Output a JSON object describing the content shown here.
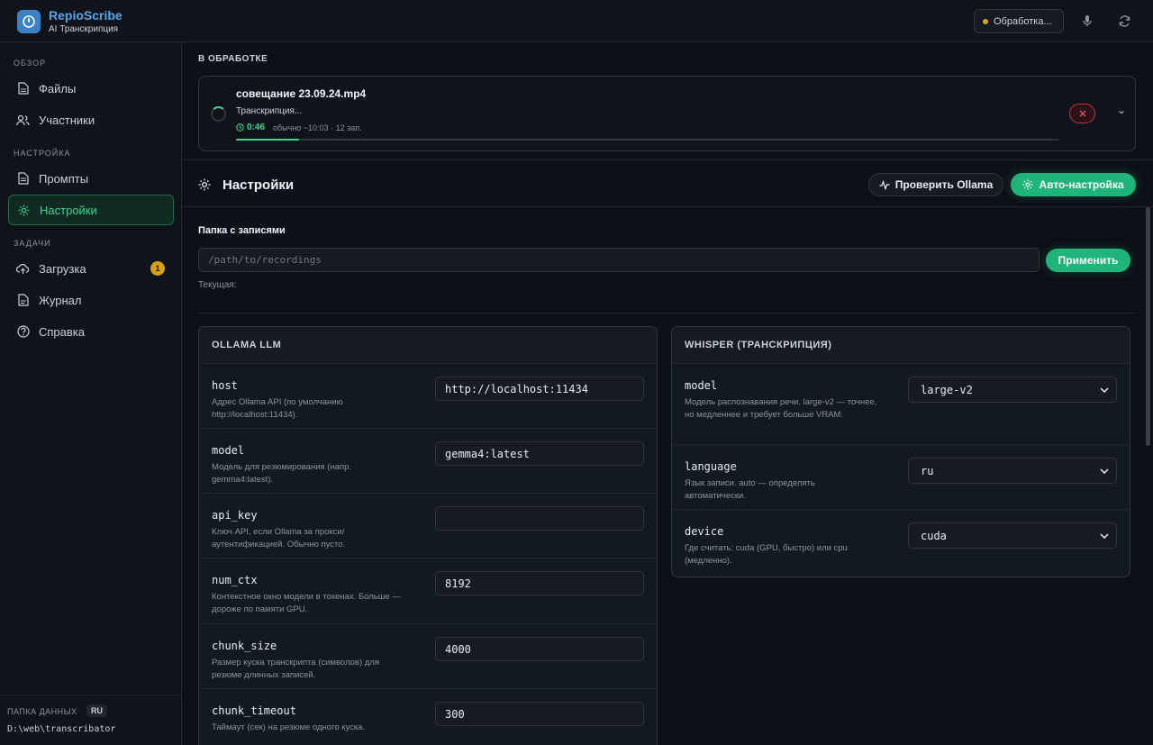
{
  "app": {
    "title": "RepioScribe",
    "subtitle": "AI Транскрипция",
    "status": "Обработка..."
  },
  "sidebar": {
    "sections": {
      "overview": "ОБЗОР",
      "settings": "НАСТРОЙКА",
      "tasks": "ЗАДАЧИ"
    },
    "items": {
      "files": "Файлы",
      "participants": "Участники",
      "prompts": "Промпты",
      "settings": "Настройки",
      "upload": "Загрузка",
      "upload_badge": "1",
      "journal": "Журнал",
      "help": "Справка"
    },
    "footer": {
      "label": "ПАПКА ДАННЫХ",
      "lang": "RU",
      "path": "D:\\web\\transcribator"
    }
  },
  "processing": {
    "label": "В ОБРАБОТКЕ",
    "file_name": "совещание 23.09.24.mp4",
    "status": "Транскрипция...",
    "timer": "0:46",
    "note": "обычно ~10:03 · 12 зап.",
    "progress": 0.077
  },
  "settings": {
    "title": "Настройки",
    "check_button": "Проверить Ollama",
    "auto_button": "Авто-настройка",
    "folder_label": "Папка с записями",
    "folder_placeholder": "/path/to/recordings",
    "apply_button": "Применить",
    "current_label": "Текущая:"
  },
  "ollama": {
    "title": "OLLAMA LLM",
    "rows": [
      {
        "key": "host",
        "desc": "Адрес Ollama API (по умолчанию http://localhost:11434).",
        "value": "http://localhost:11434"
      },
      {
        "key": "model",
        "desc": "Модель для резюмирования (напр. gemma4:latest).",
        "value": "gemma4:latest"
      },
      {
        "key": "api_key",
        "desc": "Ключ API, если Ollama за прокси/аутентификацией. Обычно пусто.",
        "value": ""
      },
      {
        "key": "num_ctx",
        "desc": "Контекстное окно модели в токенах. Больше — дороже по памяти GPU.",
        "value": "8192"
      },
      {
        "key": "chunk_size",
        "desc": "Размер куска транскрипта (символов) для резюме длинных записей.",
        "value": "4000"
      },
      {
        "key": "chunk_timeout",
        "desc": "Таймаут (сек) на резюме одного куска.",
        "value": "300"
      }
    ]
  },
  "whisper": {
    "title": "WHISPER (ТРАНСКРИПЦИЯ)",
    "rows": [
      {
        "key": "model",
        "desc": "Модель распознавания речи. large-v2 — точнее, но медленнее и требует больше VRAM.",
        "value": "large-v2"
      },
      {
        "key": "language",
        "desc": "Язык записи. auto — определять автоматически.",
        "value": "ru"
      },
      {
        "key": "device",
        "desc": "Где считать: cuda (GPU, быстро) или cpu (медленно).",
        "value": "cuda"
      }
    ]
  },
  "colors": {
    "accent": "#1fb57a",
    "brand": "#58a6e6",
    "warning": "#d4a017",
    "danger": "#b33a44"
  }
}
